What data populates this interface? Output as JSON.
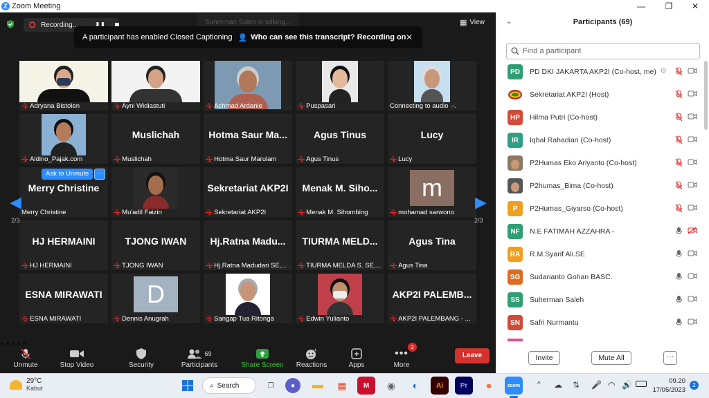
{
  "window": {
    "title": "Zoom Meeting",
    "minimize": "—",
    "maximize": "❐",
    "close": "✕"
  },
  "top": {
    "recording_label": "Recording...",
    "talking": "Suherman Saleh is talking...",
    "view_label": "View",
    "banner_text": "A participant has enabled Closed Captioning",
    "banner_link": "Who can see this transcript? Recording on",
    "banner_close": "✕"
  },
  "gallery": {
    "page_left": "2/3",
    "page_right": "2/3",
    "ask_unmute": "Ask to Unmute",
    "ask_more": "···",
    "tiles": [
      {
        "big": "",
        "name": "Adryana Bistolen",
        "mic": "muted"
      },
      {
        "big": "",
        "name": "Ayni Widiastuti",
        "mic": "muted"
      },
      {
        "big": "",
        "name": "Achmad Ardanie",
        "mic": "muted"
      },
      {
        "big": "",
        "name": "Puspasari",
        "mic": "muted"
      },
      {
        "big": "",
        "name": "Connecting to audio ·-.",
        "mic": "none"
      },
      {
        "big": "",
        "name": "Aldino_Pajak.com",
        "mic": "muted"
      },
      {
        "big": "Muslichah",
        "name": "Muslichah",
        "mic": "muted"
      },
      {
        "big": "Hotma Saur Ma...",
        "name": "Hotma Saur Marulam",
        "mic": "muted"
      },
      {
        "big": "Agus Tinus",
        "name": "Agus Tinus",
        "mic": "muted"
      },
      {
        "big": "Lucy",
        "name": "Lucy",
        "mic": "muted"
      },
      {
        "big": "Merry Christine",
        "name": "Merry Christine",
        "mic": "none"
      },
      {
        "big": "",
        "name": "Mu'adil Faizin",
        "mic": "muted"
      },
      {
        "big": "Sekretariat AKP2I",
        "name": "Sekretariat AKP2I",
        "mic": "muted"
      },
      {
        "big": "Menak M. Siho...",
        "name": "Menak M. Sihombing",
        "mic": "muted"
      },
      {
        "big": "",
        "name": "mohamad sarwono",
        "mic": "muted",
        "letter": "m"
      },
      {
        "big": "HJ HERMAINI",
        "name": "HJ HERMAINI",
        "mic": "muted"
      },
      {
        "big": "TJONG IWAN",
        "name": "TJONG IWAN",
        "mic": "muted"
      },
      {
        "big": "Hj.Ratna Madu...",
        "name": "Hj.Ratna Madudari SE,...",
        "mic": "muted"
      },
      {
        "big": "TIURMA MELD...",
        "name": "TIURMA MELDA S. SE,...",
        "mic": "muted"
      },
      {
        "big": "Agus Tina",
        "name": "Agus Tina",
        "mic": "muted"
      },
      {
        "big": "ESNA MIRAWATI",
        "name": "ESNA MIRAWATI",
        "mic": "muted"
      },
      {
        "big": "",
        "name": "Dennis Anugrah",
        "mic": "muted",
        "letter": "D"
      },
      {
        "big": "",
        "name": "Sangap Tua Ritonga",
        "mic": "muted"
      },
      {
        "big": "",
        "name": "Edwin Yulianto",
        "mic": "muted"
      },
      {
        "big": "AKP2I PALEMB...",
        "name": "AKP2I PALEMBANG - ...",
        "mic": "muted"
      }
    ]
  },
  "toolbar": {
    "unmute": "Unmute",
    "stop_video": "Stop Video",
    "security": "Security",
    "participants": "Participants",
    "participants_count": "69",
    "share_screen": "Share Screen",
    "reactions": "Reactions",
    "apps": "Apps",
    "more": "More",
    "more_badge": "2",
    "leave": "Leave"
  },
  "panel": {
    "title": "Participants (69)",
    "search_placeholder": "Find a participant",
    "invite": "Invite",
    "mute_all": "Mute All",
    "more": "···",
    "participants": [
      {
        "initials": "PD",
        "color": "#2f9e73",
        "name": "PD DKI JAKARTA AKP2I (Co-host, me)",
        "mic": "muted",
        "video": "off"
      },
      {
        "initials": "",
        "color": "#ffffff",
        "name": "Sekretariat AKP2I (Host)",
        "mic": "muted",
        "video": "off",
        "logo": true
      },
      {
        "initials": "HP",
        "color": "#d24b3a",
        "name": "Hilma Putri (Co-host)",
        "mic": "muted",
        "video": "off"
      },
      {
        "initials": "IR",
        "color": "#2f9e83",
        "name": "Iqbal Rahadian (Co-host)",
        "mic": "muted",
        "video": "off"
      },
      {
        "initials": "",
        "color": "#8a7a60",
        "name": "P2Humas Eko Ariyanto (Co-host)",
        "mic": "muted",
        "video": "off",
        "photo": true
      },
      {
        "initials": "",
        "color": "#555555",
        "name": "P2humas_Bima (Co-host)",
        "mic": "muted",
        "video": "off",
        "photo": true
      },
      {
        "initials": "P",
        "color": "#f0a020",
        "name": "P2Humas_Giyarso (Co-host)",
        "mic": "muted",
        "video": "off"
      },
      {
        "initials": "NF",
        "color": "#2f9e73",
        "name": "N.E FATIMAH AZZAHRA -",
        "mic": "on",
        "video": "off-red"
      },
      {
        "initials": "RA",
        "color": "#f0a020",
        "name": "R.M.Syarif Ali.SE",
        "mic": "on",
        "video": "off"
      },
      {
        "initials": "SG",
        "color": "#e06a20",
        "name": "Sudarianto Gohan BASC.",
        "mic": "on",
        "video": "off"
      },
      {
        "initials": "SS",
        "color": "#2f9e73",
        "name": "Suherman Saleh",
        "mic": "on",
        "video": "off"
      },
      {
        "initials": "SN",
        "color": "#d24b3a",
        "name": "Safri Nurmantu",
        "mic": "on",
        "video": "off"
      }
    ]
  },
  "taskbar": {
    "temp": "29°C",
    "weather": "Kabut",
    "search": "Search",
    "time": "09.20",
    "date": "17/05/2023",
    "notif": "2"
  }
}
